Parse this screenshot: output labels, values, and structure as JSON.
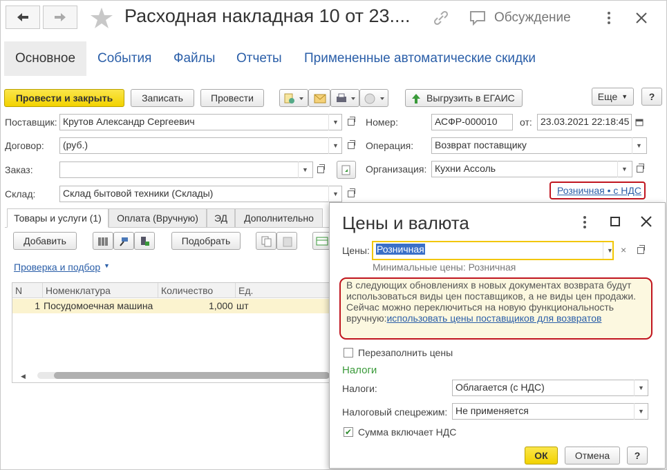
{
  "window": {
    "title": "Расходная накладная 10 от 23....",
    "discussion_label": "Обсуждение"
  },
  "top_tabs": [
    {
      "label": "Основное"
    },
    {
      "label": "События"
    },
    {
      "label": "Файлы"
    },
    {
      "label": "Отчеты"
    },
    {
      "label": "Примененные автоматические скидки"
    }
  ],
  "toolbar": {
    "post_close_label": "Провести и закрыть",
    "save_label": "Записать",
    "post_label": "Провести",
    "egais_label": "Выгрузить в ЕГАИС",
    "more_label": "Еще",
    "help_label": "?"
  },
  "form": {
    "supplier_label": "Поставщик:",
    "supplier_value": "Крутов Александр Сергеевич",
    "contract_label": "Договор:",
    "contract_value": "(руб.)",
    "order_label": "Заказ:",
    "order_value": "",
    "warehouse_label": "Склад:",
    "warehouse_value": "Склад бытовой техники (Склады)",
    "number_label": "Номер:",
    "number_value": "АСФР-000010",
    "date_label": "от:",
    "date_value": "23.03.2021 22:18:45",
    "operation_label": "Операция:",
    "operation_value": "Возврат поставщику",
    "organization_label": "Организация:",
    "organization_value": "Кухни Ассоль",
    "price_link": "Розничная • с НДС"
  },
  "inner_tabs": [
    {
      "label": "Товары и услуги (1)"
    },
    {
      "label": "Оплата (Вручную)"
    },
    {
      "label": "ЭД"
    },
    {
      "label": "Дополнительно"
    }
  ],
  "goods": {
    "add_label": "Добавить",
    "pick_label": "Подобрать",
    "check_link": "Проверка и подбор",
    "columns": [
      "N",
      "Номенклатура",
      "Количество",
      "Ед."
    ],
    "rows": [
      {
        "n": "1",
        "name": "Посудомоечная машина",
        "qty": "1,000",
        "unit": "шт"
      }
    ]
  },
  "dialog": {
    "title": "Цены и валюта",
    "prices_label": "Цены:",
    "prices_value": "Розничная",
    "min_prices": "Минимальные цены: Розничная",
    "notice_text": "В следующих обновлениях в новых документах возврата будут использоваться виды цен поставщиков, а не виды цен продажи. Сейчас можно переключиться на новую функциональность вручную:",
    "notice_link": "использовать цены поставщиков для возвратов",
    "refill_label": "Перезаполнить цены",
    "taxes_header": "Налоги",
    "taxes_label": "Налоги:",
    "taxes_value": "Облагается (с НДС)",
    "tax_regime_label": "Налоговый спецрежим:",
    "tax_regime_value": "Не применяется",
    "vat_included_label": "Сумма включает НДС",
    "ok_label": "ОК",
    "cancel_label": "Отмена",
    "help_label": "?"
  },
  "colors": {
    "accent_yellow": "#f2d200",
    "link_blue": "#2a5ea8",
    "highlight_red": "#c0141e",
    "taxes_green": "#3a9a3a",
    "row_highlight": "#fbf3cf"
  }
}
